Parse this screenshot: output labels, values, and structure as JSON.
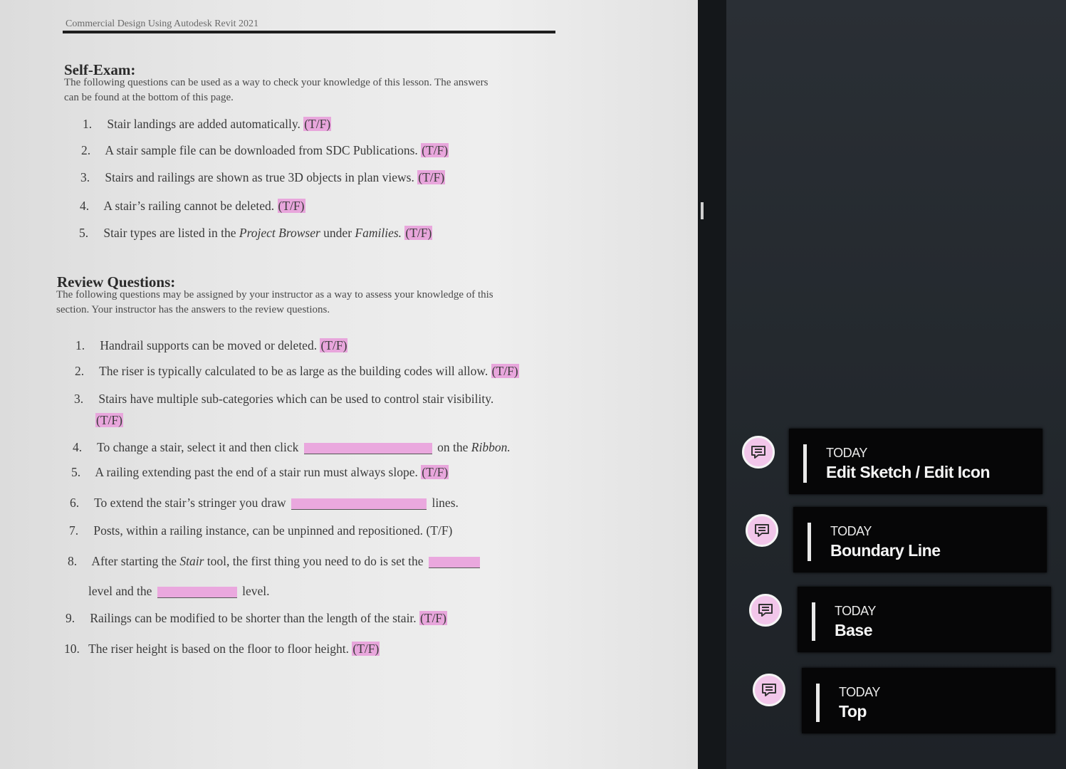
{
  "document": {
    "header": "Commercial Design Using Autodesk Revit 2021",
    "self_exam": {
      "title": "Self-Exam:",
      "intro_line1": "The following questions can be used as a way to check your knowledge of this lesson. The answers",
      "intro_line2": "can be found at the bottom of this page.",
      "questions": [
        {
          "num": "1.",
          "text": "Stair landings are added automatically.",
          "answer": "(T/F)"
        },
        {
          "num": "2.",
          "text": "A stair sample file can be downloaded from SDC Publications.",
          "answer": "(T/F)"
        },
        {
          "num": "3.",
          "text": "Stairs and railings are shown as true 3D objects in plan views.",
          "answer": "(T/F)"
        },
        {
          "num": "4.",
          "text": "A stair’s railing cannot be deleted.",
          "answer": "(T/F)"
        },
        {
          "num": "5.",
          "text_before": "Stair types are listed in the",
          "italic1": "Project Browser",
          "text_mid": "under",
          "italic2": "Families.",
          "answer": "(T/F)"
        }
      ]
    },
    "review": {
      "title": "Review Questions:",
      "intro_line1": "The following questions may be assigned by your instructor as a way to assess your knowledge of this",
      "intro_line2": "section. Your instructor has the answers to the review questions.",
      "questions": [
        {
          "num": "1.",
          "text": "Handrail supports can be moved or deleted.",
          "answer": "(T/F)"
        },
        {
          "num": "2.",
          "text": "The riser is typically calculated to be as large as the building codes will allow.",
          "answer": "(T/F)"
        },
        {
          "num": "3.",
          "text": "Stairs have multiple sub-categories which can be used to control stair visibility.",
          "answer": "(T/F)"
        },
        {
          "num": "4.",
          "text_before": "To change a stair, select it and then click",
          "text_after": "on the",
          "italic": "Ribbon."
        },
        {
          "num": "5.",
          "text": "A railing extending past the end of a stair run must always slope.",
          "answer": "(T/F)"
        },
        {
          "num": "6.",
          "text_before": "To extend the stair’s stringer you draw",
          "text_after": "lines."
        },
        {
          "num": "7.",
          "text": "Posts, within a railing instance, can be unpinned and repositioned.",
          "answer": "(T/F)"
        },
        {
          "num": "8.",
          "text_before": "After starting the",
          "italic": "Stair",
          "text_after": "tool, the first thing you need to do is set the",
          "line2_before": "level and the",
          "line2_after": "level."
        },
        {
          "num": "9.",
          "text": "Railings can be modified to be shorter than the length of the stair.",
          "answer": "(T/F)"
        },
        {
          "num": "10.",
          "text": "The riser height is based on the floor to floor height.",
          "answer": "(T/F)"
        }
      ]
    }
  },
  "notes_panel": {
    "items": [
      {
        "when": "TODAY",
        "title": "Edit Sketch / Edit Icon",
        "icon": "comment-icon"
      },
      {
        "when": "TODAY",
        "title": "Boundary Line",
        "icon": "comment-icon"
      },
      {
        "when": "TODAY",
        "title": "Base",
        "icon": "comment-icon"
      },
      {
        "when": "TODAY",
        "title": "Top",
        "icon": "comment-icon"
      }
    ],
    "accent_color": "#f2c6ea",
    "highlight_color": "#e8a6dc"
  }
}
